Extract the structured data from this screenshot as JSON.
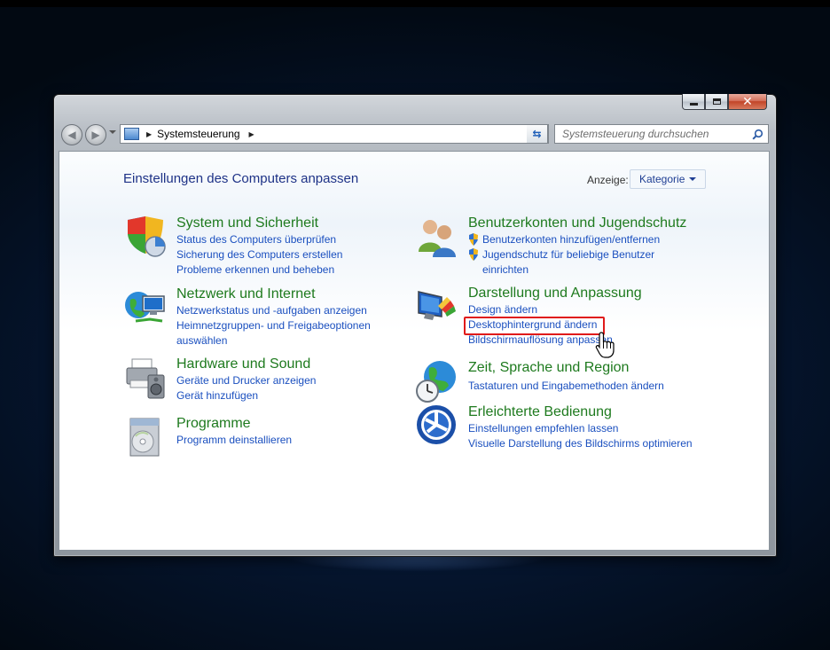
{
  "window": {
    "address_path": "Systemsteuerung",
    "search_placeholder": "Systemsteuerung durchsuchen"
  },
  "header": {
    "title": "Einstellungen des Computers anpassen",
    "view_label": "Anzeige:",
    "view_value": "Kategorie"
  },
  "categories": [
    {
      "title": "System und Sicherheit",
      "icon": "shield-icon",
      "links": [
        "Status des Computers überprüfen",
        "Sicherung des Computers erstellen",
        "Probleme erkennen und beheben"
      ]
    },
    {
      "title": "Netzwerk und Internet",
      "icon": "network-globe-icon",
      "links": [
        "Netzwerkstatus und -aufgaben anzeigen",
        "Heimnetzgruppen- und Freigabeoptionen",
        "auswählen"
      ]
    },
    {
      "title": "Hardware und Sound",
      "icon": "printer-speaker-icon",
      "links": [
        "Geräte und Drucker anzeigen",
        "Gerät hinzufügen"
      ]
    },
    {
      "title": "Programme",
      "icon": "program-disc-icon",
      "links": [
        "Programm deinstallieren"
      ]
    },
    {
      "title": "Benutzerkonten und Jugendschutz",
      "icon": "users-icon",
      "links": [
        "Benutzerkonten hinzufügen/entfernen",
        "Jugendschutz für beliebige Benutzer",
        "einrichten"
      ]
    },
    {
      "title": "Darstellung und Anpassung",
      "icon": "display-palette-icon",
      "links": [
        "Design ändern",
        "Desktophintergrund ändern",
        "Bildschirmauflösung anpassen"
      ]
    },
    {
      "title": "Zeit, Sprache und Region",
      "icon": "globe-clock-icon",
      "links": [
        "Tastaturen und Eingabemethoden ändern"
      ]
    },
    {
      "title": "Erleichterte Bedienung",
      "icon": "ease-of-access-icon",
      "links": [
        "Einstellungen empfehlen lassen",
        "Visuelle Darstellung des Bildschirms optimieren"
      ]
    }
  ],
  "highlighted_link": "Desktophintergrund ändern"
}
